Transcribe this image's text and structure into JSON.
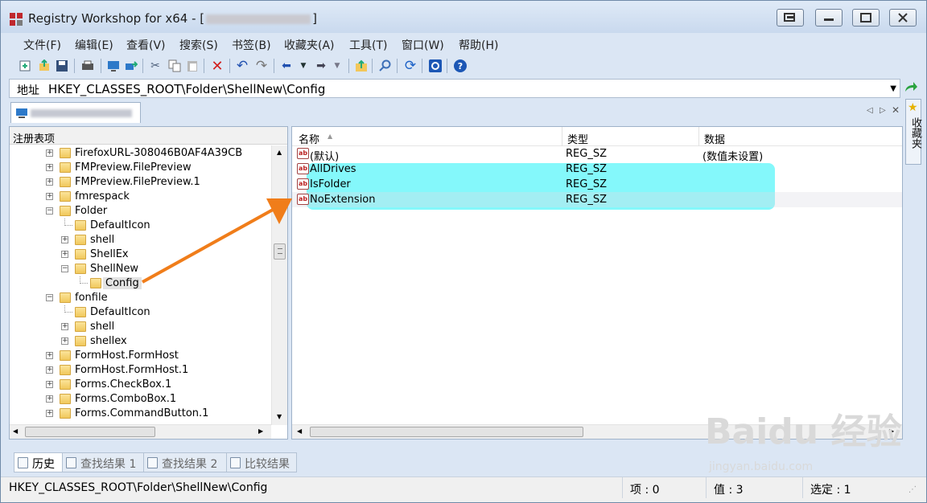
{
  "window": {
    "title": "Registry Workshop for x64 - [",
    "title_suffix": "]",
    "buttons": [
      "restore-down",
      "minimize",
      "maximize",
      "close"
    ]
  },
  "menu": [
    "文件(F)",
    "编辑(E)",
    "查看(V)",
    "搜索(S)",
    "书签(B)",
    "收藏夹(A)",
    "工具(T)",
    "窗口(W)",
    "帮助(H)"
  ],
  "address": {
    "label": "地址",
    "value": "HKEY_CLASSES_ROOT\\Folder\\ShellNew\\Config"
  },
  "favorites_label": "收藏夹",
  "tree": {
    "header": "注册表项",
    "items": [
      {
        "label": "FirefoxURL-308046B0AF4A39CB",
        "level": 0,
        "exp": "+"
      },
      {
        "label": "FMPreview.FilePreview",
        "level": 0,
        "exp": "+"
      },
      {
        "label": "FMPreview.FilePreview.1",
        "level": 0,
        "exp": "+"
      },
      {
        "label": "fmrespack",
        "level": 0,
        "exp": "+"
      },
      {
        "label": "Folder",
        "level": 0,
        "exp": "-"
      },
      {
        "label": "DefaultIcon",
        "level": 1,
        "exp": ""
      },
      {
        "label": "shell",
        "level": 1,
        "exp": "+"
      },
      {
        "label": "ShellEx",
        "level": 1,
        "exp": "+"
      },
      {
        "label": "ShellNew",
        "level": 1,
        "exp": "-"
      },
      {
        "label": "Config",
        "level": 2,
        "exp": "",
        "selected": true
      },
      {
        "label": "fonfile",
        "level": 0,
        "exp": "-"
      },
      {
        "label": "DefaultIcon",
        "level": 1,
        "exp": ""
      },
      {
        "label": "shell",
        "level": 1,
        "exp": "+"
      },
      {
        "label": "shellex",
        "level": 1,
        "exp": "+"
      },
      {
        "label": "FormHost.FormHost",
        "level": 0,
        "exp": "+"
      },
      {
        "label": "FormHost.FormHost.1",
        "level": 0,
        "exp": "+"
      },
      {
        "label": "Forms.CheckBox.1",
        "level": 0,
        "exp": "+"
      },
      {
        "label": "Forms.ComboBox.1",
        "level": 0,
        "exp": "+"
      },
      {
        "label": "Forms.CommandButton.1",
        "level": 0,
        "exp": "+"
      }
    ]
  },
  "list": {
    "columns": [
      "名称",
      "类型",
      "数据"
    ],
    "rows": [
      {
        "name": "(默认)",
        "type": "REG_SZ",
        "data": "(数值未设置)"
      },
      {
        "name": "AllDrives",
        "type": "REG_SZ",
        "data": ""
      },
      {
        "name": "IsFolder",
        "type": "REG_SZ",
        "data": ""
      },
      {
        "name": "NoExtension",
        "type": "REG_SZ",
        "data": ""
      }
    ]
  },
  "bottom_tabs": [
    "历史",
    "查找结果 1",
    "查找结果 2",
    "比较结果"
  ],
  "status": {
    "path": "HKEY_CLASSES_ROOT\\Folder\\ShellNew\\Config",
    "items": "项 : 0",
    "values": "值 : 3",
    "selected": "选定 : 1"
  },
  "watermark": {
    "main": "Baidu 经验",
    "sub": "jingyan.baidu.com"
  },
  "colors": {
    "highlight": "#6ef7fa",
    "arrow": "#f07d1a",
    "accent": "#1c57b5"
  }
}
